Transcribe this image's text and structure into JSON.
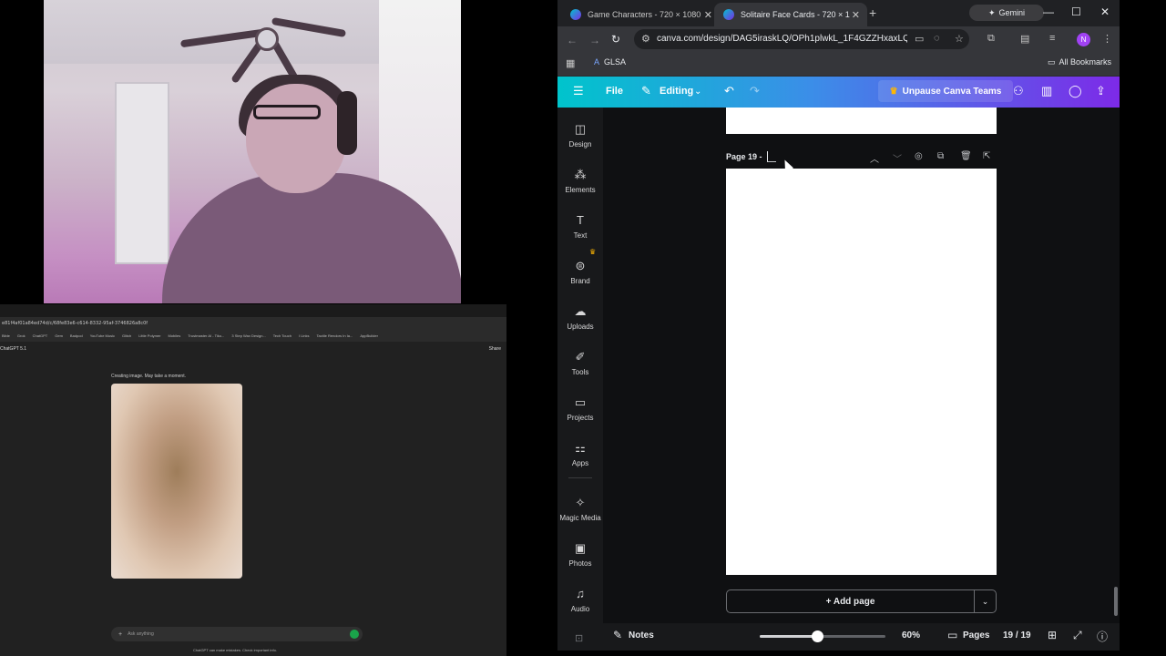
{
  "chatgpt": {
    "url": "e81f4af01a84ed74d/c/68fe83e6-c614-8332-95af-3746826a8c0f",
    "bookmarks": [
      "Bible",
      "Grok",
      "ChatGPT",
      "Gem",
      "Badpod",
      "YouTube Music",
      "Glitch",
      "Little Polymer",
      "Mobiles",
      "Trustmaster AI - Tiko...",
      "3 Step Wax Design...",
      "Tech Touch",
      "I Links",
      "Tactile Rendors In Ia...",
      "AppBuilder"
    ],
    "model": "ChatGPT 5.1",
    "share_label": "Share",
    "status": "Creating image. May take a moment.",
    "input_placeholder": "Ask anything",
    "footnote": "ChatGPT can make mistakes. Check important info."
  },
  "browser": {
    "tabs": [
      {
        "title": "Game Characters - 720 × 1080px",
        "active": false
      },
      {
        "title": "Solitaire Face Cards - 720 × 1080",
        "active": true
      }
    ],
    "gemini_label": "Gemini",
    "url": "canva.com/design/DAG5iraskLQ/OPh1plwkL_1F4GZZHxaxLQ/e...",
    "profile_initial": "N",
    "bookmark_glsa": "GLSA",
    "bookmark_all": "All Bookmarks"
  },
  "canva": {
    "menu_file": "File",
    "mode_label": "Editing",
    "unpause_label": "Unpause Canva Teams",
    "sidebar": [
      "Design",
      "Elements",
      "Text",
      "Brand",
      "Uploads",
      "Tools",
      "Projects",
      "Apps",
      "Magic Media",
      "Photos",
      "Audio"
    ],
    "page_title": "Page 19 -",
    "add_page_label": "+ Add page",
    "notes_label": "Notes",
    "zoom_value": "60%",
    "zoom_fraction": 0.46,
    "pages_label": "Pages",
    "page_count": "19 / 19"
  },
  "icons": {
    "accent_start": "#00c4cc",
    "accent_end": "#7d2ae8"
  }
}
